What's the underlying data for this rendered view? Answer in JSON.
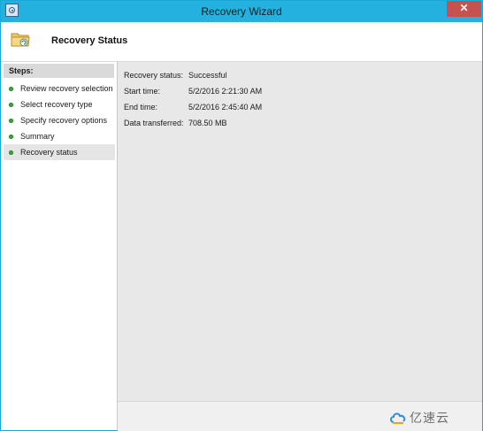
{
  "window": {
    "title": "Recovery Wizard",
    "close_glyph": "✕",
    "accent_color": "#24b1e0"
  },
  "header": {
    "icon": "folder-restore-icon",
    "title": "Recovery Status"
  },
  "sidebar": {
    "heading": "Steps:",
    "items": [
      {
        "label": "Review recovery selection",
        "status": "completed"
      },
      {
        "label": "Select recovery type",
        "status": "completed"
      },
      {
        "label": "Specify recovery options",
        "status": "completed"
      },
      {
        "label": "Summary",
        "status": "completed"
      },
      {
        "label": "Recovery status",
        "status": "current"
      }
    ]
  },
  "status": {
    "rows": [
      {
        "label": "Recovery status:",
        "value": "Successful"
      },
      {
        "label": "Start time:",
        "value": "5/2/2016 2:21:30 AM"
      },
      {
        "label": "End time:",
        "value": "5/2/2016 2:45:40 AM"
      },
      {
        "label": "Data transferred:",
        "value": "708.50 MB"
      }
    ]
  },
  "watermark": {
    "text": "亿速云"
  }
}
